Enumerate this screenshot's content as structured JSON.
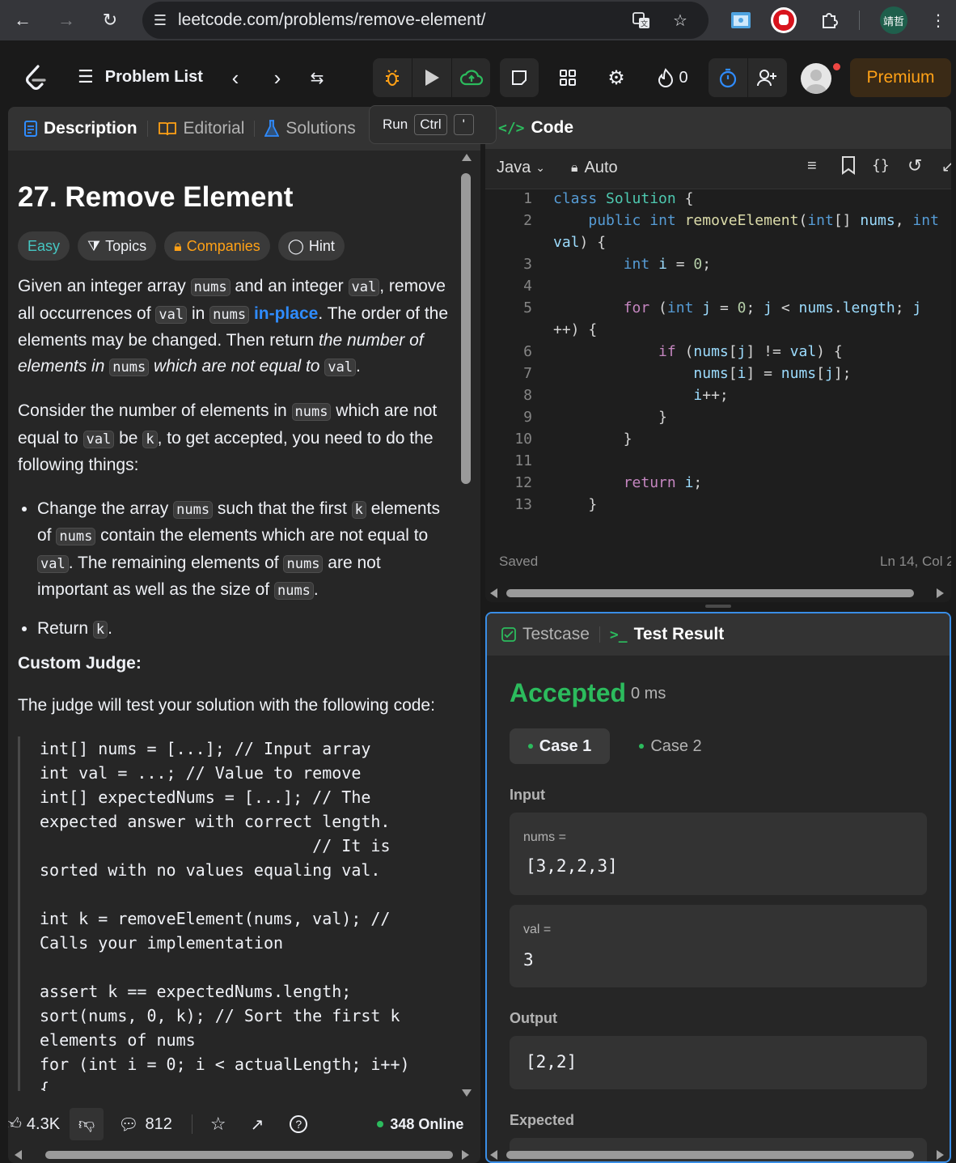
{
  "browser": {
    "url": "leetcode.com/problems/remove-element/",
    "profile_name": "靖哲"
  },
  "nav": {
    "problem_list_label": "Problem List",
    "streak_count": "0",
    "premium_label": "Premium",
    "tooltip": {
      "label": "Run",
      "key1": "Ctrl",
      "key2": "'",
      "behind": "Submit"
    }
  },
  "left_tabs": {
    "description": "Description",
    "editorial": "Editorial",
    "solutions": "Solutions"
  },
  "problem": {
    "title": "27. Remove Element",
    "tags": {
      "difficulty": "Easy",
      "topics": "Topics",
      "companies": "Companies",
      "hint": "Hint"
    },
    "p1": {
      "a": "Given an integer array ",
      "c1": "nums",
      "b": " and an integer ",
      "c2": "val",
      "c": ", remove all occurrences of ",
      "c3": "val",
      "d": " in ",
      "c4": "nums",
      "e": " ",
      "link": "in-place",
      "f": ". The order of the elements may be changed. Then return ",
      "g": "the number of elements in ",
      "c5": "nums",
      "h": " which are not equal to ",
      "c6": "val",
      "i": "."
    },
    "p2": {
      "a": "Consider the number of elements in ",
      "c1": "nums",
      "b": " which are not equal to ",
      "c2": "val",
      "c": " be ",
      "c3": "k",
      "d": ", to get accepted, you need to do the following things:"
    },
    "bullet1": {
      "a": "Change the array ",
      "c1": "nums",
      "b": " such that the first ",
      "c2": "k",
      "c": " elements of ",
      "c3": "nums",
      "d": " contain the elements which are not equal to ",
      "c4": "val",
      "e": ". The remaining elements of ",
      "c5": "nums",
      "f": " are not important as well as the size of ",
      "c6": "nums",
      "g": "."
    },
    "bullet2": {
      "a": "Return ",
      "c1": "k",
      "b": "."
    },
    "custom_judge": "Custom Judge:",
    "judge_intro": "The judge will test your solution with the following code:",
    "judge_code": "int[] nums = [...]; // Input array\nint val = ...; // Value to remove\nint[] expectedNums = [...]; // The\nexpected answer with correct length.\n                            // It is\nsorted with no values equaling val.\n\nint k = removeElement(nums, val); //\nCalls your implementation\n\nassert k == expectedNums.length;\nsort(nums, 0, k); // Sort the first k\nelements of nums\nfor (int i = 0; i < actualLength; i++)\n{"
  },
  "footer": {
    "likes": "4.3K",
    "comments": "812",
    "online": "348 Online"
  },
  "code_panel": {
    "title": "Code",
    "language": "Java",
    "autocomplete": "Auto",
    "status": "Saved",
    "cursor": "Ln 14, Col 2"
  },
  "result_panel": {
    "tab_testcase": "Testcase",
    "tab_result": "Test Result",
    "verdict": "Accepted",
    "runtime": "0 ms",
    "case1": "Case 1",
    "case2": "Case 2",
    "input_label": "Input",
    "nums_label": "nums =",
    "nums_value": "[3,2,2,3]",
    "val_label": "val =",
    "val_value": "3",
    "output_label": "Output",
    "output_value": "[2,2]",
    "expected_label": "Expected"
  },
  "colors": {
    "accent_blue": "#2f8cff",
    "premium": "#ffa116",
    "easy": "#46c6c2",
    "accepted": "#2cbb5d"
  }
}
